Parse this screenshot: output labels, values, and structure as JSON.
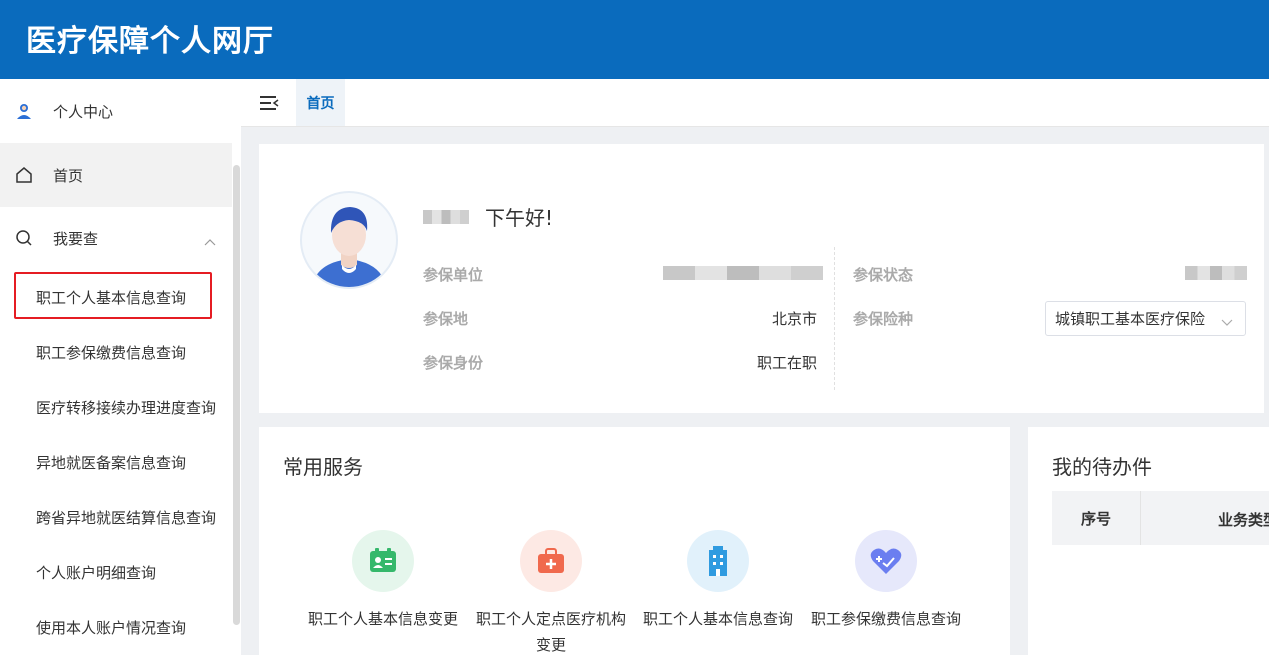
{
  "app": {
    "title": "医疗保障个人网厅"
  },
  "sidebar": {
    "personal_center": "个人中心",
    "home": "首页",
    "query_group": "我要查",
    "items": [
      "职工个人基本信息查询",
      "职工参保缴费信息查询",
      "医疗转移接续办理进度查询",
      "异地就医备案信息查询",
      "跨省异地就医结算信息查询",
      "个人账户明细查询",
      "使用本人账户情况查询"
    ]
  },
  "tabs": {
    "home": "首页"
  },
  "profile": {
    "greeting": "下午好!",
    "fields": {
      "unit_label": "参保单位",
      "place_label": "参保地",
      "place_value": "北京市",
      "identity_label": "参保身份",
      "identity_value": "职工在职",
      "status_label": "参保状态",
      "type_label": "参保险种",
      "type_value": "城镇职工基本医疗保险"
    }
  },
  "services": {
    "title": "常用服务",
    "items": [
      {
        "label": "职工个人基本信息变更",
        "icon": "id-card-icon",
        "bg": "#e5f6ec",
        "color": "#35b86b"
      },
      {
        "label": "职工个人定点医疗机构变更",
        "icon": "medkit-icon",
        "bg": "#fde9e4",
        "color": "#f0694d"
      },
      {
        "label": "职工个人基本信息查询",
        "icon": "building-icon",
        "bg": "#e1f1fb",
        "color": "#2f9be0"
      },
      {
        "label": "职工参保缴费信息查询",
        "icon": "heart-plus-icon",
        "bg": "#e6e8fb",
        "color": "#6b7ef0"
      }
    ]
  },
  "todo": {
    "title": "我的待办件",
    "col_index": "序号",
    "col_type": "业务类型"
  },
  "colors": {
    "brand": "#0a6bbd",
    "highlight": "#e51c23"
  }
}
